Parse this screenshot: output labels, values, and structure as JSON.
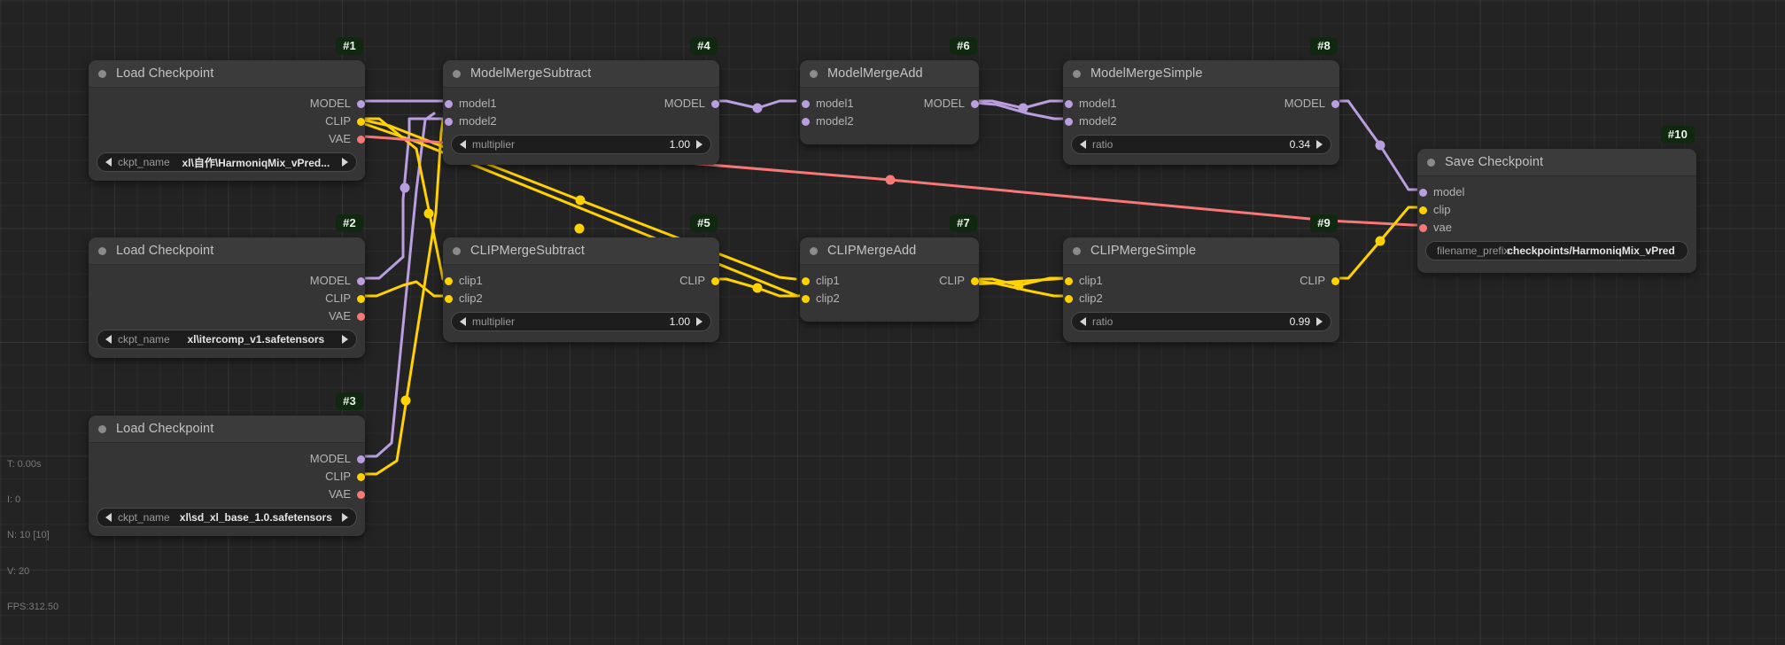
{
  "app": {
    "name": "ComfyUI node graph canvas"
  },
  "stats": {
    "time": "T: 0.00s",
    "iterations": "I: 0",
    "nodes": "N: 10 [10]",
    "vertices": "V: 20",
    "fps": "FPS:312.50"
  },
  "colors": {
    "canvas_bg": "#232323",
    "node_bg": "#353535",
    "node_header_bg": "#3b3b3b",
    "badge_bg": "#102810",
    "model_port": "#b99fe0",
    "clip_port": "#ffd200",
    "vae_port": "#f87878",
    "link_model": "#b99fe0",
    "link_clip": "#ffd200",
    "link_vae": "#f87878"
  },
  "nodes": [
    {
      "id": "#1",
      "title": "Load Checkpoint",
      "inputs": [],
      "outputs": [
        {
          "label": "MODEL",
          "type": "model"
        },
        {
          "label": "CLIP",
          "type": "clip"
        },
        {
          "label": "VAE",
          "type": "vae"
        }
      ],
      "widget": {
        "kind": "combo",
        "name": "ckpt_name",
        "value": "xl\\自作\\HarmoniqMix_vPred..."
      }
    },
    {
      "id": "#2",
      "title": "Load Checkpoint",
      "inputs": [],
      "outputs": [
        {
          "label": "MODEL",
          "type": "model"
        },
        {
          "label": "CLIP",
          "type": "clip"
        },
        {
          "label": "VAE",
          "type": "vae"
        }
      ],
      "widget": {
        "kind": "combo",
        "name": "ckpt_name",
        "value": "xl\\itercomp_v1.safetensors"
      }
    },
    {
      "id": "#3",
      "title": "Load Checkpoint",
      "inputs": [],
      "outputs": [
        {
          "label": "MODEL",
          "type": "model"
        },
        {
          "label": "CLIP",
          "type": "clip"
        },
        {
          "label": "VAE",
          "type": "vae"
        }
      ],
      "widget": {
        "kind": "combo",
        "name": "ckpt_name",
        "value": "xl\\sd_xl_base_1.0.safetensors"
      }
    },
    {
      "id": "#4",
      "title": "ModelMergeSubtract",
      "inputs": [
        {
          "label": "model1",
          "type": "model"
        },
        {
          "label": "model2",
          "type": "model"
        }
      ],
      "outputs": [
        {
          "label": "MODEL",
          "type": "model"
        }
      ],
      "widget": {
        "kind": "number",
        "name": "multiplier",
        "value": "1.00"
      }
    },
    {
      "id": "#5",
      "title": "CLIPMergeSubtract",
      "inputs": [
        {
          "label": "clip1",
          "type": "clip"
        },
        {
          "label": "clip2",
          "type": "clip"
        }
      ],
      "outputs": [
        {
          "label": "CLIP",
          "type": "clip"
        }
      ],
      "widget": {
        "kind": "number",
        "name": "multiplier",
        "value": "1.00"
      }
    },
    {
      "id": "#6",
      "title": "ModelMergeAdd",
      "inputs": [
        {
          "label": "model1",
          "type": "model"
        },
        {
          "label": "model2",
          "type": "model"
        }
      ],
      "outputs": [
        {
          "label": "MODEL",
          "type": "model"
        }
      ],
      "widget": null
    },
    {
      "id": "#7",
      "title": "CLIPMergeAdd",
      "inputs": [
        {
          "label": "clip1",
          "type": "clip"
        },
        {
          "label": "clip2",
          "type": "clip"
        }
      ],
      "outputs": [
        {
          "label": "CLIP",
          "type": "clip"
        }
      ],
      "widget": null
    },
    {
      "id": "#8",
      "title": "ModelMergeSimple",
      "inputs": [
        {
          "label": "model1",
          "type": "model"
        },
        {
          "label": "model2",
          "type": "model"
        }
      ],
      "outputs": [
        {
          "label": "MODEL",
          "type": "model"
        }
      ],
      "widget": {
        "kind": "number",
        "name": "ratio",
        "value": "0.34"
      }
    },
    {
      "id": "#9",
      "title": "CLIPMergeSimple",
      "inputs": [
        {
          "label": "clip1",
          "type": "clip"
        },
        {
          "label": "clip2",
          "type": "clip"
        }
      ],
      "outputs": [
        {
          "label": "CLIP",
          "type": "clip"
        }
      ],
      "widget": {
        "kind": "number",
        "name": "ratio",
        "value": "0.99"
      }
    },
    {
      "id": "#10",
      "title": "Save Checkpoint",
      "inputs": [
        {
          "label": "model",
          "type": "model"
        },
        {
          "label": "clip",
          "type": "clip"
        },
        {
          "label": "vae",
          "type": "vae"
        }
      ],
      "outputs": [],
      "widget": {
        "kind": "text",
        "name": "filename_prefix",
        "value": "checkpoints/HarmoniqMix_vPred_"
      }
    }
  ]
}
